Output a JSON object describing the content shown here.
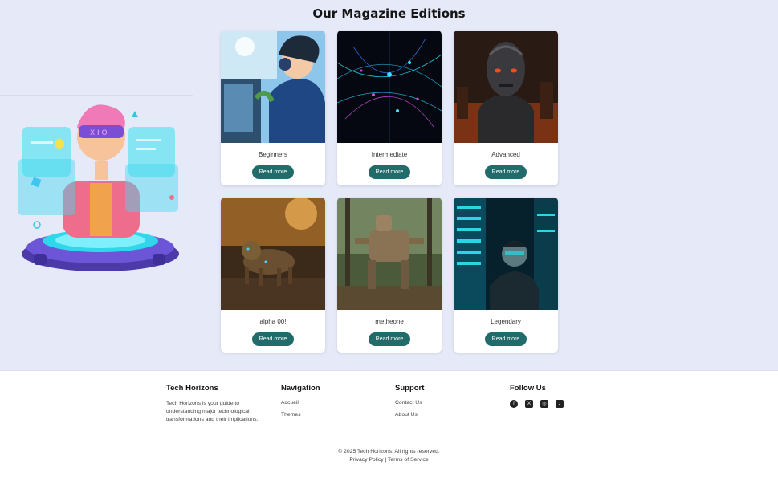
{
  "page": {
    "title": "Our Magazine Editions"
  },
  "cards": [
    {
      "label": "Beginners",
      "button": "Read more",
      "scene": "anime-gamer"
    },
    {
      "label": "Intermediate",
      "button": "Read more",
      "scene": "neural-network"
    },
    {
      "label": "Advanced",
      "button": "Read more",
      "scene": "cyborg"
    },
    {
      "label": "alpha 00!",
      "button": "Read more",
      "scene": "robot-tiger"
    },
    {
      "label": "metheone",
      "button": "Read more",
      "scene": "mech-walker"
    },
    {
      "label": "Legendary",
      "button": "Read more",
      "scene": "server-room-man"
    }
  ],
  "footer": {
    "brand": {
      "heading": "Tech Horizons",
      "description": "Tech Horizons is your guide to understanding major technological transformations and their implications."
    },
    "navigation": {
      "heading": "Navigation",
      "links": [
        "Accueil",
        "Themes"
      ]
    },
    "support": {
      "heading": "Support",
      "links": [
        "Contact Us",
        "About Us"
      ]
    },
    "follow": {
      "heading": "Follow Us",
      "icons": [
        "facebook-icon",
        "x-icon",
        "instagram-icon",
        "tiktok-icon"
      ]
    },
    "copyright": "© 2025 Tech Horizons. All rights reserved.",
    "privacy": "Privacy Policy",
    "separator": "|",
    "terms": "Terms of Service"
  },
  "colors": {
    "button": "#216b6b",
    "background": "#e6e9f7"
  }
}
